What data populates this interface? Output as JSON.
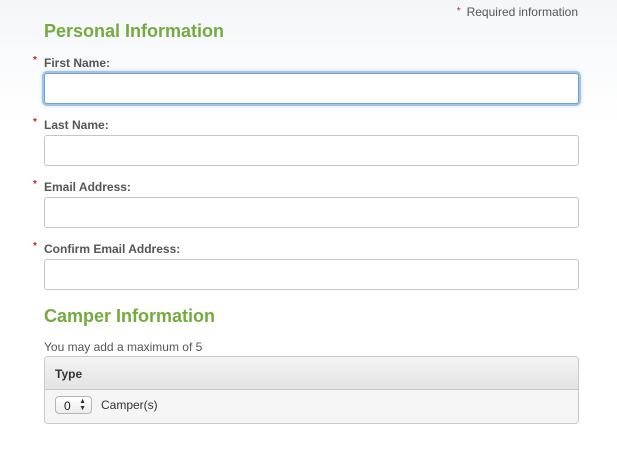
{
  "required_note": {
    "star": "*",
    "text": "Required information"
  },
  "personal_section": {
    "title": "Personal Information",
    "fields": [
      {
        "label": "First Name:",
        "value": "",
        "required": true,
        "focused": true
      },
      {
        "label": "Last Name:",
        "value": "",
        "required": true,
        "focused": false
      },
      {
        "label": "Email Address:",
        "value": "",
        "required": true,
        "focused": false
      },
      {
        "label": "Confirm Email Address:",
        "value": "",
        "required": true,
        "focused": false
      }
    ]
  },
  "camper_section": {
    "title": "Camper Information",
    "note": "You may add a maximum of 5",
    "table_header": "Type",
    "rows": [
      {
        "count": "0",
        "label": "Camper(s)"
      }
    ]
  },
  "colors": {
    "section_title": "#75aa3f",
    "required_star": "#c0262b",
    "focus_ring": "#9ec3ee"
  },
  "icons": {
    "select_arrows": "up-down-arrows-icon"
  }
}
